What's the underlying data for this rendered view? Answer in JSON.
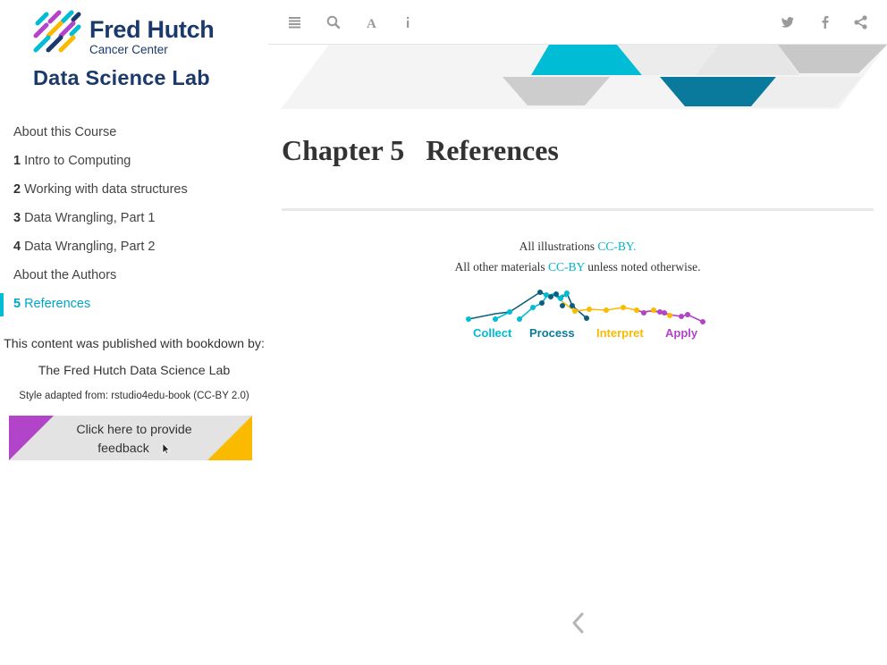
{
  "logo": {
    "title": "Fred Hutch",
    "subtitle": "Cancer Center",
    "lab": "Data Science Lab"
  },
  "toolbar": {
    "icons": [
      "toc-icon",
      "search-icon",
      "font-icon",
      "info-icon",
      "twitter-icon",
      "facebook-icon",
      "share-icon"
    ]
  },
  "toc": {
    "items": [
      {
        "num": "",
        "label": "About this Course"
      },
      {
        "num": "1",
        "label": "Intro to Computing"
      },
      {
        "num": "2",
        "label": "Working with data structures"
      },
      {
        "num": "3",
        "label": "Data Wrangling, Part 1"
      },
      {
        "num": "4",
        "label": "Data Wrangling, Part 2"
      },
      {
        "num": "",
        "label": "About the Authors"
      },
      {
        "num": "5",
        "label": "References"
      }
    ],
    "active_index": 6
  },
  "sidebar_footer": {
    "published_by": "This content was published with bookdown by:",
    "publisher": "The Fred Hutch Data Science Lab",
    "style_note": "Style adapted from: rstudio4edu-book (CC-BY 2.0)",
    "feedback_label": "Click here to provide feedback"
  },
  "main": {
    "chapter_number": "Chapter 5",
    "chapter_title": "References",
    "credit_line1_prefix": "All illustrations",
    "credit_line1_link": "CC-BY.",
    "credit_line2_prefix": "All other materials",
    "credit_line2_link": "CC-BY",
    "credit_line2_suffix": "unless noted otherwise."
  },
  "workflow": {
    "labels": [
      "Collect",
      "Process",
      "Interpret",
      "Apply"
    ]
  },
  "colors": {
    "accent_teal": "#00bcd4",
    "dark_teal": "#0a7a9c",
    "purple": "#b144c9",
    "yellow": "#f9ba00",
    "navy": "#1b3a6b"
  }
}
